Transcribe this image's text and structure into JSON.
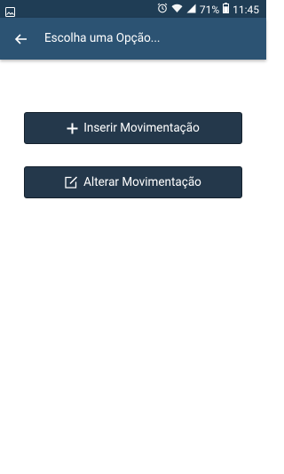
{
  "status_bar": {
    "battery_percent": "71%",
    "time": "11:45",
    "icons": [
      "image-icon",
      "alarm-icon",
      "wifi-icon",
      "signal-icon",
      "battery-icon"
    ]
  },
  "app_bar": {
    "title": "Escolha uma Opção...",
    "back_icon": "arrow-left-icon"
  },
  "buttons": [
    {
      "label": "Inserir Movimentação",
      "icon": "plus-icon"
    },
    {
      "label": "Alterar Movimentação",
      "icon": "edit-icon"
    }
  ],
  "colors": {
    "status_bar": "#1f3d55",
    "app_bar": "#2c5373",
    "button": "#24384b",
    "background": "#ffffff"
  }
}
